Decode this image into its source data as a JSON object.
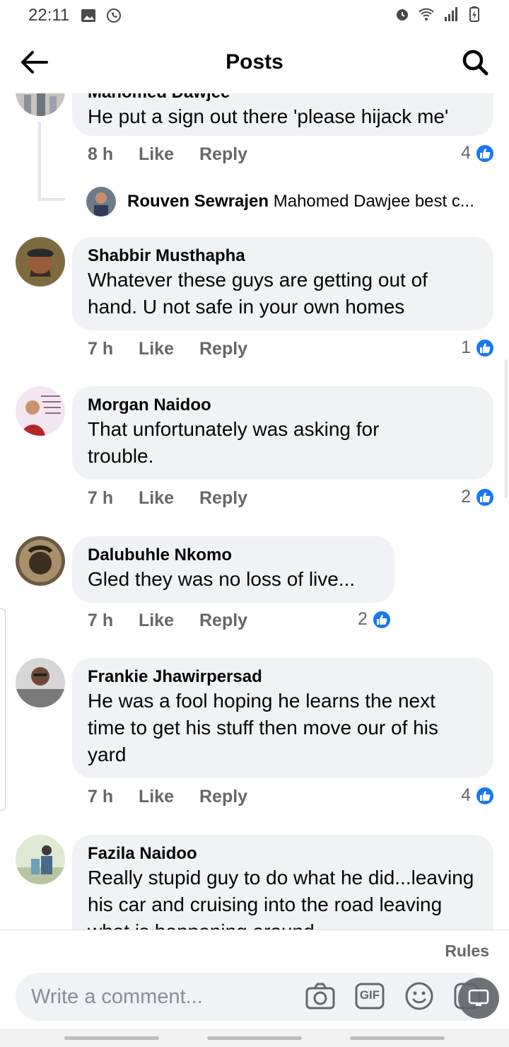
{
  "status_bar": {
    "time": "22:11"
  },
  "header": {
    "title": "Posts"
  },
  "comments": [
    {
      "author": "Mahomed Dawjee",
      "text": "He put a sign out there 'please hijack me'",
      "time": "8 h",
      "likes": "4",
      "reply_preview": {
        "author": "Rouven Sewrajen",
        "text": "Mahomed Dawjee best c..."
      }
    },
    {
      "author": "Shabbir Musthapha",
      "text": "Whatever these guys are getting out of hand. U not safe in your own homes",
      "time": "7 h",
      "likes": "1"
    },
    {
      "author": "Morgan Naidoo",
      "text": "That unfortunately  was asking for trouble.",
      "time": "7 h",
      "likes": "2"
    },
    {
      "author": "Dalubuhle Nkomo",
      "text": "Gled they was no loss of live...",
      "time": "7 h",
      "likes": "2"
    },
    {
      "author": "Frankie Jhawirpersad",
      "text": "He was a fool hoping he learns the next time to get his stuff then move our of his yard",
      "time": "7 h",
      "likes": "4"
    },
    {
      "author": "Fazila Naidoo",
      "text": "Really stupid guy to do what he did...leaving his car and cruising into the road leaving what is happening around",
      "time": "",
      "likes": ""
    }
  ],
  "actions": {
    "like_label": "Like",
    "reply_label": "Reply"
  },
  "composer": {
    "rules_label": "Rules",
    "placeholder": "Write a comment...",
    "gif_label": "GIF"
  },
  "colors": {
    "accent": "#1877f2",
    "bubble": "#f0f2f5",
    "muted": "#65676b"
  },
  "icons": [
    "back-arrow-icon",
    "search-icon",
    "camera-icon",
    "gif-icon",
    "emoji-icon",
    "sticker-icon",
    "like-icon"
  ]
}
